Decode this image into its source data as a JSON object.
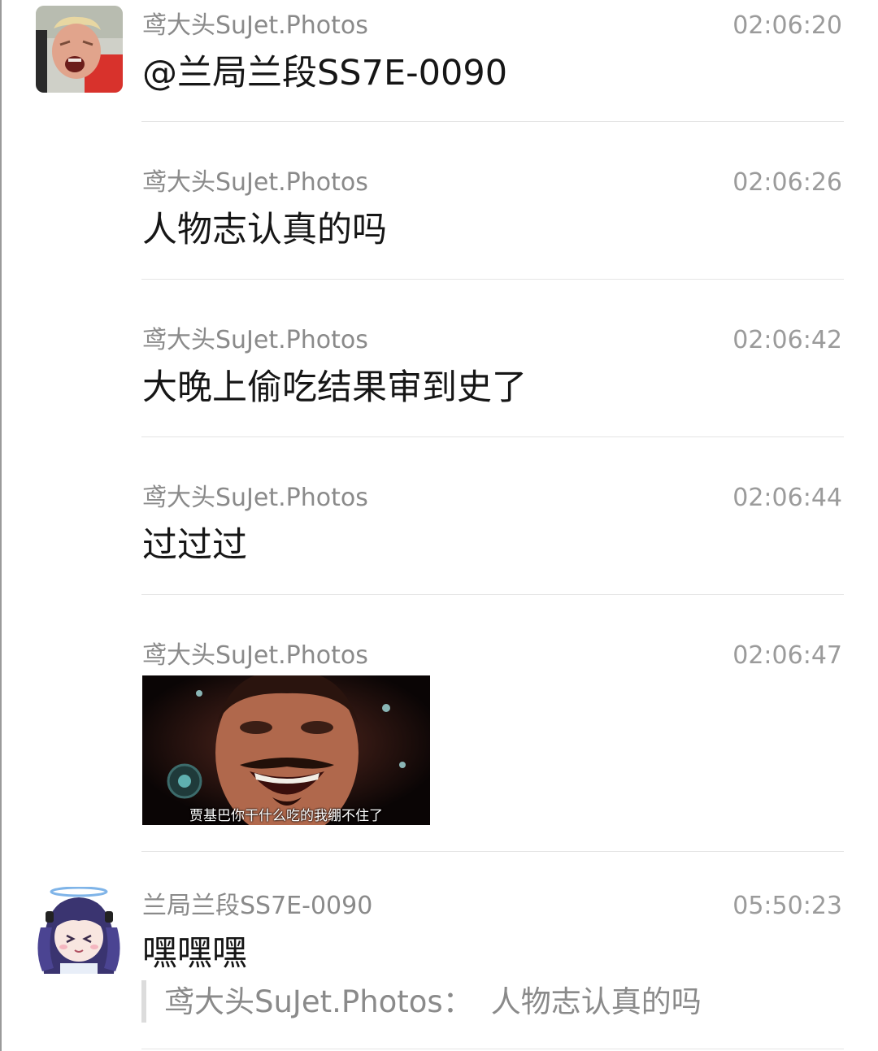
{
  "messages": [
    {
      "sender": "鸢大头SuJet.Photos",
      "time": "02:06:20",
      "text": "@兰局兰段SS7E-0090"
    },
    {
      "sender": "鸢大头SuJet.Photos",
      "time": "02:06:26",
      "text": "人物志认真的吗"
    },
    {
      "sender": "鸢大头SuJet.Photos",
      "time": "02:06:42",
      "text": "大晚上偷吃结果审到史了"
    },
    {
      "sender": "鸢大头SuJet.Photos",
      "time": "02:06:44",
      "text": "过过过"
    },
    {
      "sender": "鸢大头SuJet.Photos",
      "time": "02:06:47",
      "image_caption": "贾基巴你干什么吃的我绷不住了"
    },
    {
      "sender": "兰局兰段SS7E-0090",
      "time": "05:50:23",
      "text": "嘿嘿嘿",
      "quote": {
        "sender": "鸢大头SuJet.Photos：",
        "text": "人物志认真的吗"
      }
    }
  ]
}
